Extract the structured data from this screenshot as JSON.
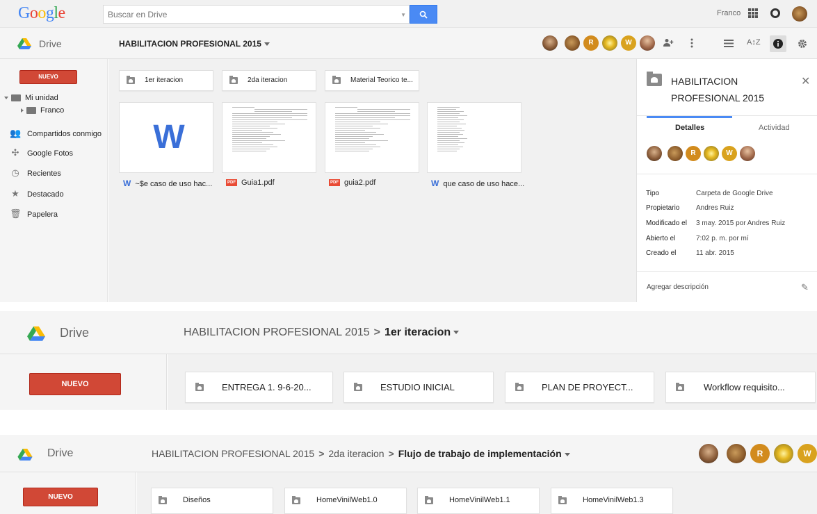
{
  "colors": {
    "accent_blue": "#4a8af4",
    "new_red": "#d14836",
    "google_blue": "#4285f4",
    "google_red": "#ea4335",
    "google_yellow": "#fbbc05",
    "google_green": "#34a853"
  },
  "topbar": {
    "logo": {
      "G": "G",
      "o1": "o",
      "o2": "o",
      "g": "g",
      "l": "l",
      "e": "e"
    },
    "search_placeholder": "Buscar en Drive",
    "search_icon": "search-icon",
    "user_name": "Franco"
  },
  "section1": {
    "brand": "Drive",
    "breadcrumb": "HABILITACION PROFESIONAL 2015",
    "collaborator_initials": [
      "R",
      "W"
    ],
    "new_button": "NUEVO",
    "nav": {
      "my_drive": "Mi unidad",
      "franco": "Franco",
      "shared": "Compartidos conmigo",
      "photos": "Google Fotos",
      "recent": "Recientes",
      "starred": "Destacado",
      "trash": "Papelera"
    },
    "folders": [
      "1er iteracion",
      "2da iteracion",
      "Material Teorico te..."
    ],
    "files": [
      {
        "name": "~$e caso de uso hac...",
        "type": "word"
      },
      {
        "name": "Guia1.pdf",
        "type": "pdf",
        "badge": "PDF"
      },
      {
        "name": "guia2.pdf",
        "type": "pdf",
        "badge": "PDF"
      },
      {
        "name": "que caso de uso hace...",
        "type": "word"
      }
    ],
    "word_glyph": "W",
    "details": {
      "title": "HABILITACION PROFESIONAL 2015",
      "tab_details": "Detalles",
      "tab_activity": "Actividad",
      "initials": [
        "R",
        "W"
      ],
      "props": [
        {
          "k": "Tipo",
          "v": "Carpeta de Google Drive"
        },
        {
          "k": "Propietario",
          "v": "Andres Ruiz"
        },
        {
          "k": "Modificado el",
          "v": "3 may. 2015 por Andres Ruiz"
        },
        {
          "k": "Abierto el",
          "v": "7:02 p. m. por mí"
        },
        {
          "k": "Creado el",
          "v": "11 abr. 2015"
        }
      ],
      "add_description": "Agregar descripción"
    }
  },
  "section2": {
    "brand": "Drive",
    "crumb_parent": "HABILITACION PROFESIONAL 2015",
    "crumb_current": "1er iteracion",
    "new_button": "NUEVO",
    "folders": [
      "ENTREGA 1. 9-6-20...",
      "ESTUDIO INICIAL",
      "PLAN DE PROYECT...",
      "Workflow requisito..."
    ]
  },
  "section3": {
    "brand": "Drive",
    "crumb_root": "HABILITACION PROFESIONAL 2015",
    "crumb_mid": "2da iteracion",
    "crumb_current": "Flujo de trabajo de implementación",
    "new_button": "NUEVO",
    "initials": [
      "R",
      "W"
    ],
    "folders": [
      "Diseños",
      "HomeVinilWeb1.0",
      "HomeVinilWeb1.1",
      "HomeVinilWeb1.3"
    ]
  }
}
